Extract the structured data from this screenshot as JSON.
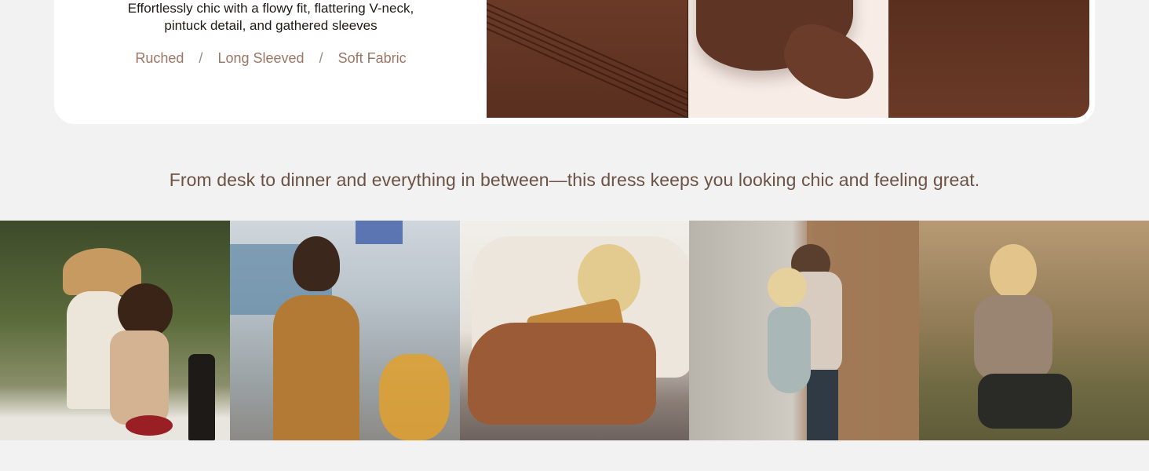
{
  "product": {
    "description_lines": [
      "Effortlessly chic with a flowy fit, flattering V-neck,",
      "pintuck detail, and gathered sleeves"
    ],
    "features": [
      "Ruched",
      "Long Sleeved",
      "Soft Fabric"
    ],
    "feature_separator": "/"
  },
  "tagline": "From desk to dinner and everything in between—this dress keeps you looking chic and feeling great.",
  "colors": {
    "page_bg": "#f2f2f2",
    "card_bg": "#ffffff",
    "fabric_brown": "#5e3424",
    "feature_text": "#9a7665",
    "tagline_text": "#6b5244"
  }
}
